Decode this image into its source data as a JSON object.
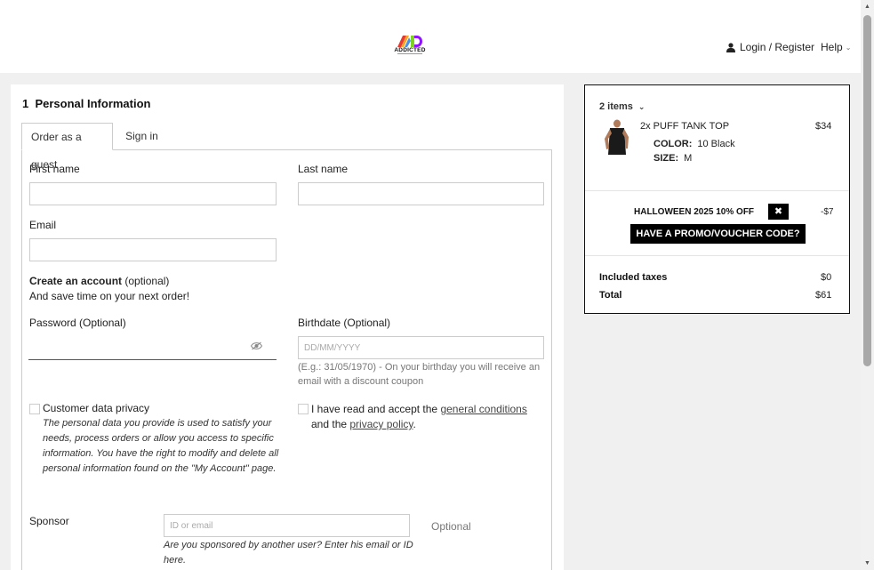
{
  "header": {
    "logo_text": "ADDICTED",
    "login_label": "Login / Register",
    "help_label": "Help"
  },
  "form": {
    "section_number": "1",
    "section_title": "Personal Information",
    "tabs": [
      {
        "label": "Order as a guest",
        "active": true
      },
      {
        "label": "Sign in",
        "active": false
      }
    ],
    "first_name_label": "First name",
    "last_name_label": "Last name",
    "email_label": "Email",
    "create_account_bold": "Create an account",
    "create_account_optional": " (optional)",
    "create_account_sub": "And save time on your next order!",
    "password_label": "Password (Optional)",
    "birthdate_label": "Birthdate (Optional)",
    "birthdate_placeholder": "DD/MM/YYYY",
    "birthdate_hint": "(E.g.: 31/05/1970) - On your birthday you will receive an email with a discount coupon",
    "privacy_label": "Customer data privacy",
    "privacy_text": "The personal data you provide is used to satisfy your needs, process orders or allow you access to specific information. You have the right to modify and delete all personal information found on the \"My Account\" page.",
    "terms_prefix": "I have read and accept the ",
    "terms_link1": "general conditions",
    "terms_middle": " and the ",
    "terms_link2": "privacy policy",
    "terms_suffix": ".",
    "sponsor_label": "Sponsor",
    "sponsor_placeholder": "ID or email",
    "sponsor_optional": "Optional",
    "sponsor_hint": "Are you sponsored by another user? Enter his email or ID here."
  },
  "cart": {
    "items_count": "2 items",
    "product": {
      "name": "2x PUFF TANK TOP",
      "price": "$34",
      "color_label": "COLOR:",
      "color_value": "10 Black",
      "size_label": "SIZE:",
      "size_value": "M"
    },
    "promo": {
      "name": "HALLOWEEN 2025 10% OFF",
      "remove_symbol": "✖",
      "value": "-$7",
      "button_label": "HAVE A PROMO/VOUCHER CODE?"
    },
    "taxes_label": "Included taxes",
    "taxes_value": "$0",
    "total_label": "Total",
    "total_value": "$61"
  },
  "colors": {
    "accent": "#000000",
    "border": "#cccccc",
    "page_bg": "#f0f0f0"
  }
}
